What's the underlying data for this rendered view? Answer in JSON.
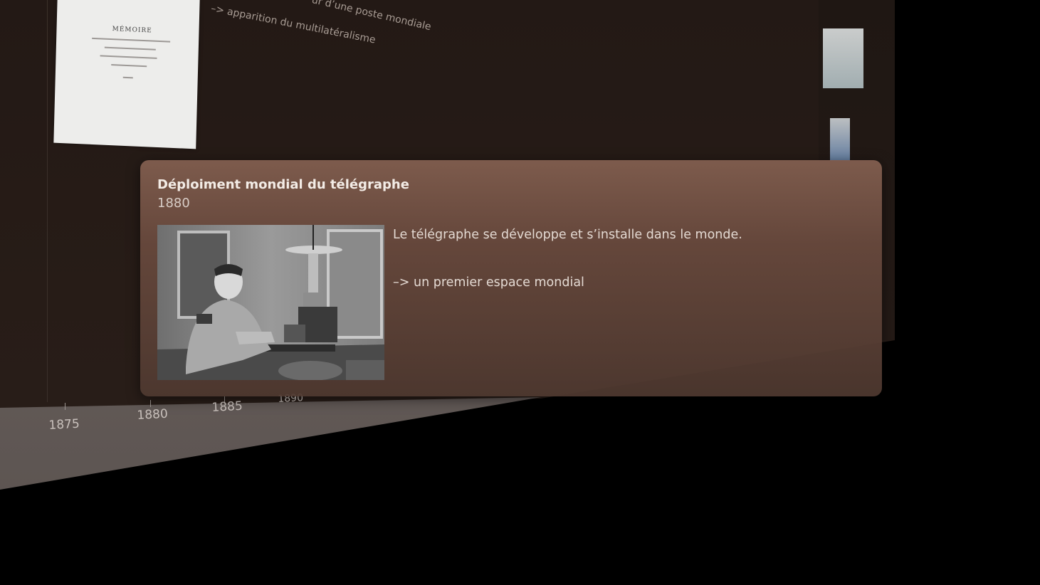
{
  "card": {
    "title": "Déploiment mondial du télégraphe",
    "year": "1880",
    "description": "Le télégraphe se développe et s’installe dans le monde.",
    "link_text": "–> un premier espace mondial",
    "photo_icon": "telegraph-operator-photo"
  },
  "background": {
    "wall_texts": [
      "ur d’une poste mondiale",
      "–> apparition du multilatéralisme"
    ],
    "document_heading": "MÉMOIRE",
    "timeline_years": [
      "1875",
      "1880",
      "1885",
      "1890"
    ]
  },
  "colors": {
    "wall": "#241a16",
    "card_top": "#805d4e",
    "card_bottom": "#4f3930",
    "timeline_band": "#6e6562"
  }
}
